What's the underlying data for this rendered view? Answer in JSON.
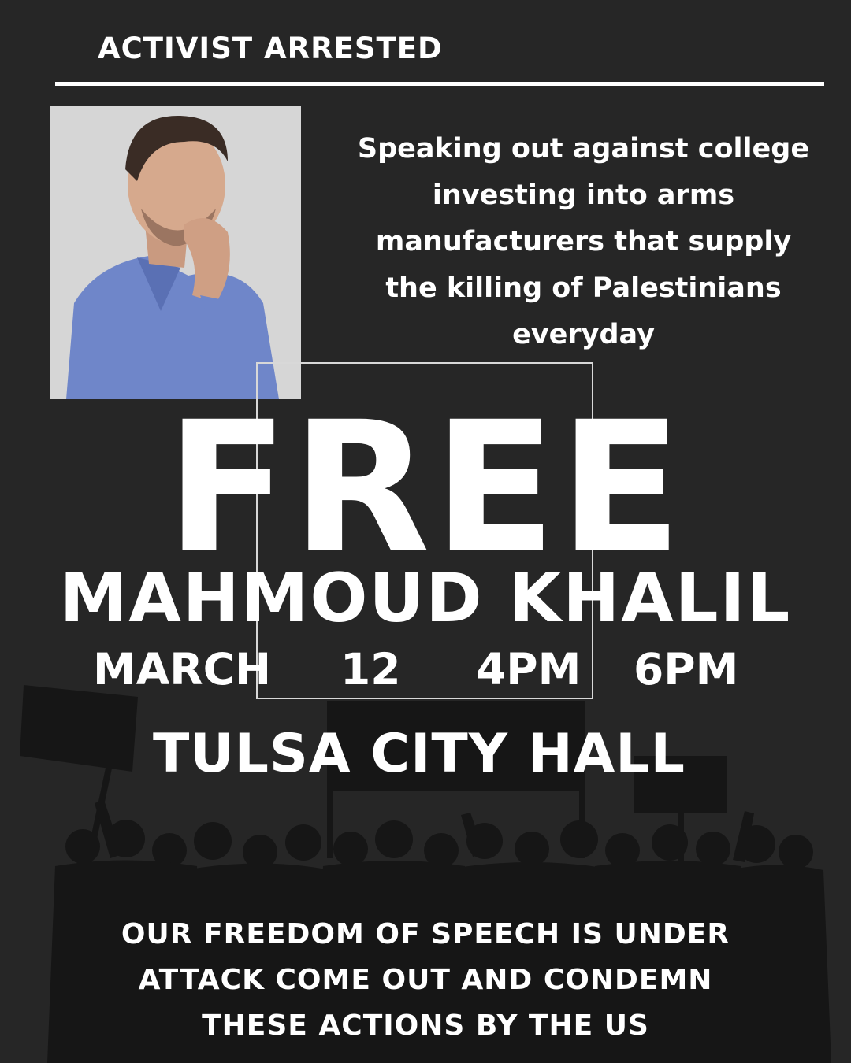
{
  "header": {
    "title": "ACTIVIST ARRESTED"
  },
  "statement": {
    "lines": [
      "Speaking out against college",
      "investing into arms",
      "manufacturers that supply",
      "the killing of Palestinians",
      "everyday"
    ]
  },
  "headline": {
    "free": "FREE",
    "name": "MAHMOUD KHALIL"
  },
  "event": {
    "month": "MARCH",
    "day": "12",
    "start": "4PM",
    "end": "6PM",
    "venue": "TULSA CITY HALL"
  },
  "footer": {
    "lines": [
      "OUR FREEDOM OF SPEECH IS UNDER",
      "ATTACK COME OUT AND CONDEMN",
      "THESE ACTIONS BY THE US"
    ]
  },
  "colors": {
    "background": "#262626",
    "text": "#ffffff",
    "crowd": "#161616"
  }
}
